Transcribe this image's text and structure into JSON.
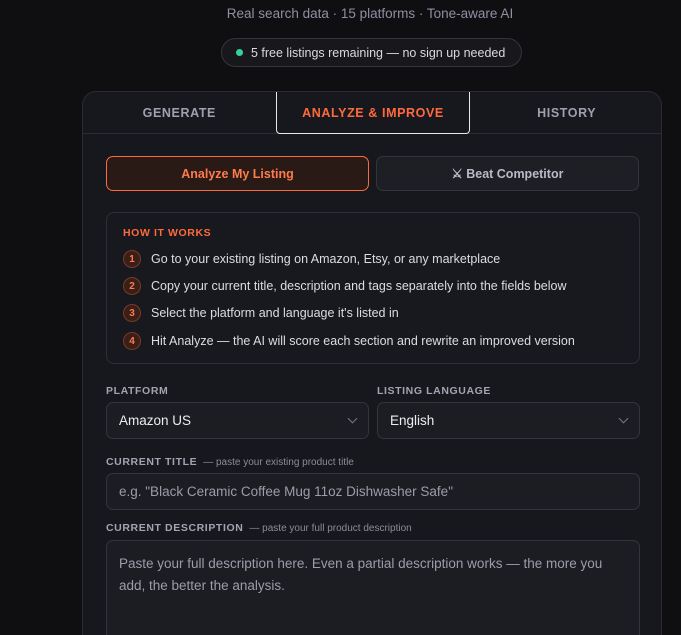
{
  "header": {
    "subtitle": "Real search data · 15 platforms · Tone-aware AI",
    "free_badge": "5 free listings remaining — no sign up needed",
    "badge_color": "#34d399"
  },
  "tabs": [
    {
      "label": "GENERATE"
    },
    {
      "label": "ANALYZE & IMPROVE",
      "active": true
    },
    {
      "label": "HISTORY"
    }
  ],
  "modes": {
    "analyze_label": "Analyze My Listing",
    "competitor_label": "⚔ Beat Competitor"
  },
  "how_it_works": {
    "title": "HOW IT WORKS",
    "steps": [
      {
        "num": "1",
        "text": "Go to your existing listing on Amazon, Etsy, or any marketplace"
      },
      {
        "num": "2",
        "text": "Copy your current title, description and tags separately into the fields below"
      },
      {
        "num": "3",
        "text": "Select the platform and language it's listed in"
      },
      {
        "num": "4",
        "text": "Hit Analyze — the AI will score each section and rewrite an improved version"
      }
    ]
  },
  "form": {
    "platform_label": "PLATFORM",
    "platform_value": "Amazon US",
    "language_label": "LISTING LANGUAGE",
    "language_value": "English",
    "title_label": "CURRENT TITLE",
    "title_hint": "— paste your existing product title",
    "title_placeholder": "e.g. \"Black Ceramic Coffee Mug 11oz Dishwasher Safe\"",
    "desc_label": "CURRENT DESCRIPTION",
    "desc_hint": "— paste your full product description",
    "desc_placeholder": "Paste your full description here. Even a partial description works — the more you add, the better the analysis."
  },
  "colors": {
    "accent": "#ff6a3d",
    "background": "#0f0f11",
    "card": "#17181d"
  }
}
